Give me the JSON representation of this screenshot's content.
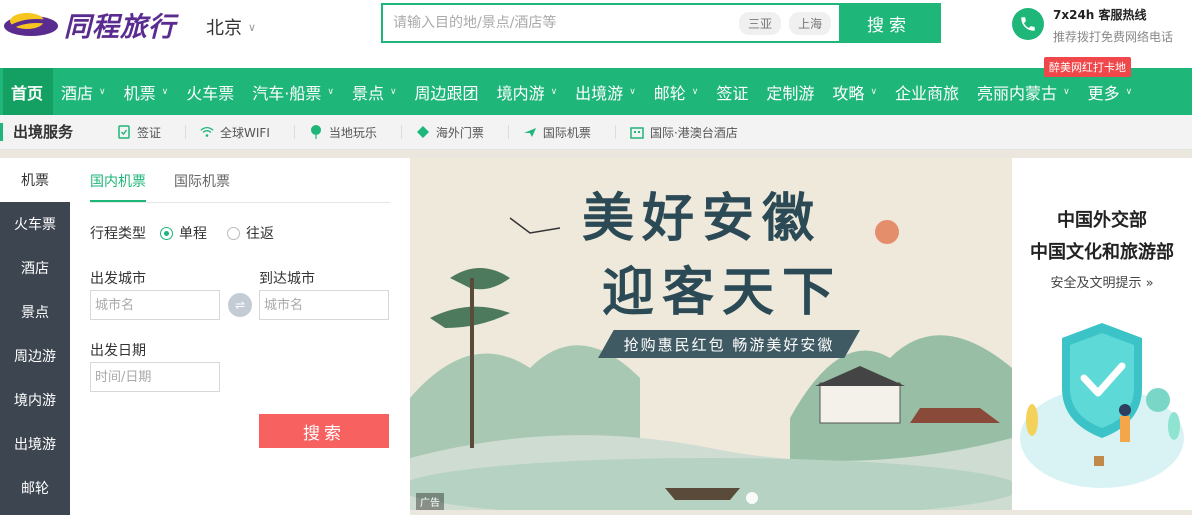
{
  "header": {
    "logo_text": "同程旅行",
    "city": "北京",
    "search": {
      "placeholder": "请输入目的地/景点/酒店等",
      "hot_tags": [
        "三亚",
        "上海"
      ],
      "button_label": "搜索"
    },
    "hotline": {
      "title": "7x24h 客服热线",
      "subtitle": "推荐拨打免费网络电话"
    }
  },
  "nav": {
    "items": [
      {
        "label": "首页",
        "active": true,
        "dropdown": false
      },
      {
        "label": "酒店",
        "dropdown": true
      },
      {
        "label": "机票",
        "dropdown": true
      },
      {
        "label": "火车票",
        "dropdown": false
      },
      {
        "label": "汽车·船票",
        "dropdown": true
      },
      {
        "label": "景点",
        "dropdown": true
      },
      {
        "label": "周边跟团",
        "dropdown": false
      },
      {
        "label": "境内游",
        "dropdown": true
      },
      {
        "label": "出境游",
        "dropdown": true
      },
      {
        "label": "邮轮",
        "dropdown": true
      },
      {
        "label": "签证",
        "dropdown": false
      },
      {
        "label": "定制游",
        "dropdown": false
      },
      {
        "label": "攻略",
        "dropdown": true
      },
      {
        "label": "企业商旅",
        "dropdown": false
      },
      {
        "label": "亮丽内蒙古",
        "dropdown": true
      },
      {
        "label": "更多",
        "dropdown": true
      }
    ],
    "promo_badge": "醉美网红打卡地"
  },
  "subnav": {
    "title": "出境服务",
    "items": [
      {
        "label": "签证",
        "icon": "visa-icon"
      },
      {
        "label": "全球WIFI",
        "icon": "wifi-icon"
      },
      {
        "label": "当地玩乐",
        "icon": "balloon-icon"
      },
      {
        "label": "海外门票",
        "icon": "ticket-icon"
      },
      {
        "label": "国际机票",
        "icon": "plane-icon"
      },
      {
        "label": "国际·港澳台酒店",
        "icon": "hotel-icon"
      }
    ]
  },
  "booking": {
    "side_tabs": [
      "机票",
      "火车票",
      "酒店",
      "景点",
      "周边游",
      "境内游",
      "出境游",
      "邮轮"
    ],
    "active_side_tab": "机票",
    "form_tabs": [
      "国内机票",
      "国际机票"
    ],
    "active_form_tab": "国内机票",
    "trip_type_label": "行程类型",
    "trip_options": [
      "单程",
      "往返"
    ],
    "selected_trip": "单程",
    "from_label": "出发城市",
    "from_placeholder": "城市名",
    "to_label": "到达城市",
    "to_placeholder": "城市名",
    "date_label": "出发日期",
    "date_placeholder": "时间/日期",
    "submit_label": "搜索"
  },
  "banner": {
    "title_line1": "美好安徽",
    "title_line2": "迎客天下",
    "slogan": "抢购惠民红包 畅游美好安徽",
    "ad_tag": "广告"
  },
  "notice": {
    "line1": "中国外交部",
    "line2": "中国文化和旅游部",
    "link": "安全及文明提示 »"
  },
  "colors": {
    "brand_green": "#1fb67a",
    "brand_purple": "#5b2c8f",
    "side_tab_bg": "#3d4650",
    "submit_red": "#f76160",
    "promo_red": "#f0484a"
  }
}
